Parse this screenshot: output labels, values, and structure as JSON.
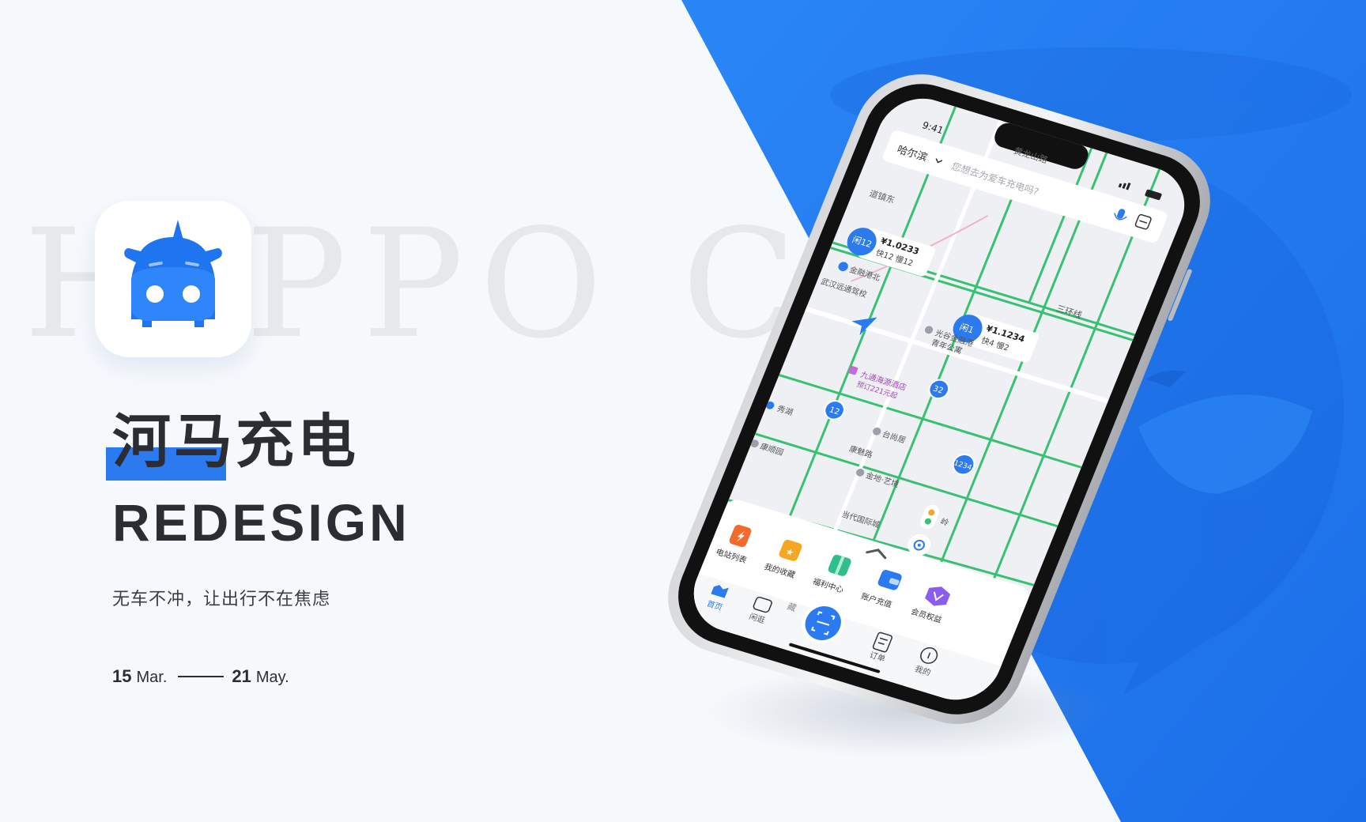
{
  "hero": {
    "watermark": "HIPPO CH",
    "title_cn": "河马充电",
    "title_en": "REDESIGN",
    "slogan": "无车不冲，让出行不在焦虑",
    "date_start_day": "15",
    "date_start_month": "Mar.",
    "date_end_day": "21",
    "date_end_month": "May."
  },
  "colors": {
    "accent": "#2b7af0",
    "map_road": "#38c172",
    "text_dark": "#2b2d33"
  },
  "phone": {
    "status_time": "9:41",
    "city": "哈尔滨",
    "search_placeholder": "您想去为爱车充电吗?",
    "map_labels": {
      "road_top": "黄龙山路",
      "road_left": "道镇东",
      "ring_road": "三环线",
      "metro_jinrong": "金融港北",
      "poi_school": "武汉远通驾校",
      "poi_guanggu": "光谷金融港",
      "poi_youth": "青年公寓",
      "hotel": "九通海源酒店",
      "hotel_price": "预订221元起",
      "metro_xiuhu": "秀湖",
      "poi_taishangju": "台尚居",
      "road_kang": "康魅路",
      "poi_jindi": "金地·艺境",
      "poi_kangyuan": "康顺园",
      "poi_dangdai": "当代国际城",
      "road_ling": "岭",
      "road_cang": "藏"
    },
    "stations": [
      {
        "badge": "闲12",
        "price": "¥1.0233",
        "detail": "快12 慢12"
      },
      {
        "badge": "闲1",
        "price": "¥1.1234",
        "detail": "快4 慢2"
      }
    ],
    "clusters": [
      "32",
      "12",
      "1234"
    ],
    "shortcuts": [
      "电站列表",
      "我的收藏",
      "福利中心",
      "账户充值",
      "会员权益"
    ],
    "tabs": [
      "首页",
      "闲逛",
      "订单",
      "我的"
    ]
  }
}
